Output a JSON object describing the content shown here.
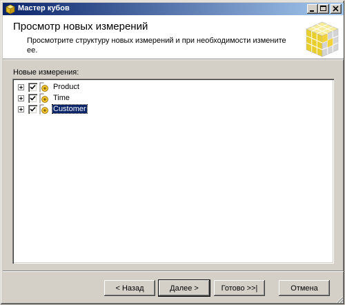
{
  "window": {
    "title": "Мастер кубов"
  },
  "header": {
    "title": "Просмотр новых измерений",
    "subtitle": "Просмотрите структуру новых измерений и при необходимости измените ее."
  },
  "dimensions": {
    "label": "Новые измерения:",
    "items": [
      {
        "label": "Product",
        "checked": true,
        "selected": false
      },
      {
        "label": "Time",
        "checked": true,
        "selected": false
      },
      {
        "label": "Customer",
        "checked": true,
        "selected": true
      }
    ]
  },
  "buttons": {
    "back": "< Назад",
    "next": "Далее >",
    "finish": "Готово >>|",
    "cancel": "Отмена"
  },
  "colors": {
    "titlebar_start": "#0a246a",
    "titlebar_end": "#a6caf0",
    "selection": "#0a246a",
    "cube_yellow": "#f2d33a"
  },
  "icons": {
    "title": "cube-icon",
    "header": "cube-grid-icon",
    "dimension": "dimension-icon"
  }
}
